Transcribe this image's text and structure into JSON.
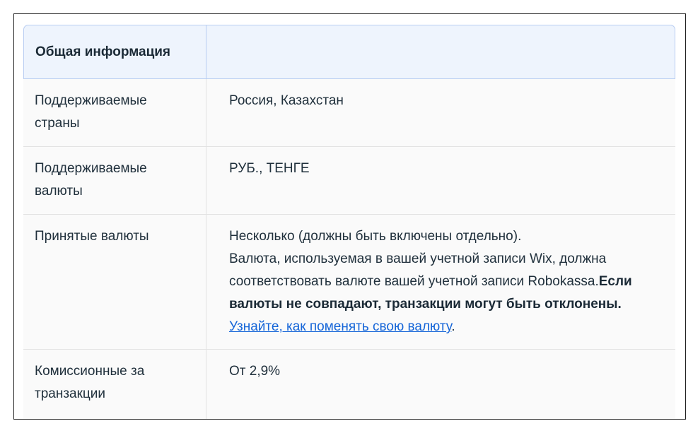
{
  "table": {
    "header": {
      "title": "Общая информация",
      "second": ""
    },
    "rows": [
      {
        "label": "Поддерживаемые страны",
        "value": "Россия, Казахстан"
      },
      {
        "label": "Поддерживаемые валюты",
        "value": "РУБ., ТЕНГЕ"
      },
      {
        "label": "Принятые валюты",
        "line1": "Несколько (должны быть включены отдельно).",
        "line2": "Валюта, используемая в вашей учетной записи Wix, должна соответствовать валюте вашей учетной записи Robokassa.",
        "bold": "Если валюты не совпадают, транзакции могут быть отклонены.",
        "space": " ",
        "link": "Узнайте, как поменять свою валюту",
        "trail": "."
      },
      {
        "label": "Комиссионные за транзакции",
        "value": "От 2,9%"
      }
    ]
  },
  "colors": {
    "header_bg": "#eef4fd",
    "header_border": "#b8cdf2",
    "row_bg": "#fafafa",
    "link": "#1565d8",
    "text": "#20303c"
  }
}
